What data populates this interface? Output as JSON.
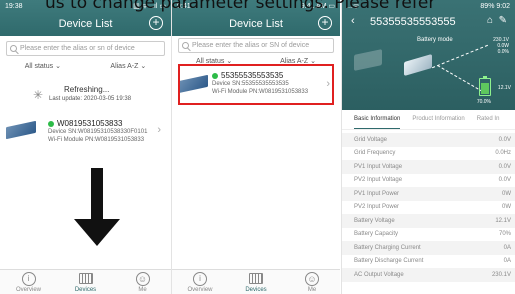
{
  "caption": "us to change parameter settings. Please refer",
  "panel1": {
    "status": {
      "time": "19:38",
      "right": "▥ ᯤ ..ıl ▭"
    },
    "title": "Device List",
    "search_placeholder": "Please enter the alias or sn of device",
    "filter_status": "All status",
    "filter_alias": "Alias A-Z",
    "refreshing": "Refreshing...",
    "last_update": "Last update: 2020-03-05 19:38",
    "device": {
      "name": "W0819531053833",
      "sn": "Device SN:W08195310538330F0101",
      "wifi": "Wi-Fi Module PN:W0819531053833"
    },
    "tabs": [
      {
        "label": "Overview",
        "icon": "info-icon"
      },
      {
        "label": "Devices",
        "icon": "devices-icon"
      },
      {
        "label": "Me",
        "icon": "person-icon"
      }
    ]
  },
  "panel2": {
    "status": {
      "time": "9:41",
      "right": "9:41 AM ▭"
    },
    "title": "Device List",
    "search_placeholder": "Please enter the alias or SN of device",
    "filter_status": "All status",
    "filter_alias": "Alias A-Z",
    "device": {
      "name": "55355535553535",
      "sn": "Device SN:55355535553535",
      "wifi": "Wi-Fi Module PN:W0819531053833"
    },
    "tabs": [
      {
        "label": "Overview",
        "icon": "info-icon"
      },
      {
        "label": "Devices",
        "icon": "devices-icon"
      },
      {
        "label": "Me",
        "icon": "person-icon"
      }
    ]
  },
  "panel3": {
    "status": {
      "left": "...ᯤ",
      "right": "89% 9:02"
    },
    "title": "55355535553555",
    "mode": "Battery mode",
    "battery_top": [
      "230.1V",
      "0.0W",
      "0.0%"
    ],
    "battery_voltage": "12.1V",
    "battery_pct": "70.0%",
    "inverter_label": "Inverter",
    "tabs": [
      "Basic Information",
      "Product Information",
      "Rated In"
    ],
    "rows": [
      {
        "label": "Grid Voltage",
        "value": "0.0V"
      },
      {
        "label": "Grid Frequency",
        "value": "0.0Hz"
      },
      {
        "label": "PV1 Input Voltage",
        "value": "0.0V"
      },
      {
        "label": "PV2 Input Voltage",
        "value": "0.0V"
      },
      {
        "label": "PV1 Input Power",
        "value": "0W"
      },
      {
        "label": "PV2 Input Power",
        "value": "0W"
      },
      {
        "label": "Battery Voltage",
        "value": "12.1V"
      },
      {
        "label": "Battery Capacity",
        "value": "70%"
      },
      {
        "label": "Battery Charging Current",
        "value": "0A"
      },
      {
        "label": "Battery Discharge Current",
        "value": "0A"
      },
      {
        "label": "AC Output Voltage",
        "value": "230.1V"
      }
    ]
  }
}
